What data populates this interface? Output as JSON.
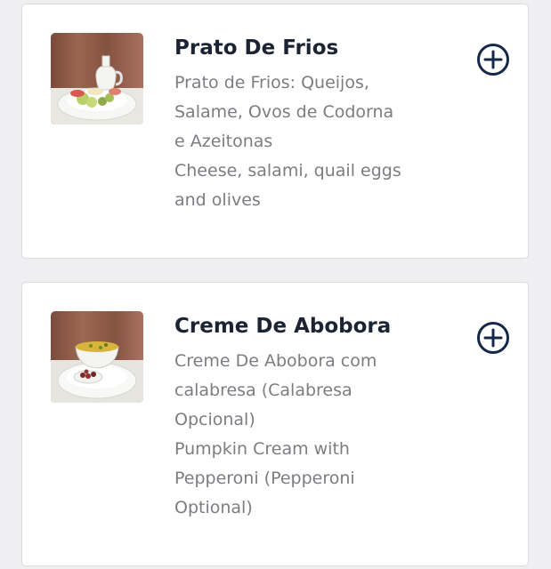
{
  "items": [
    {
      "title": "Prato De Frios",
      "description_lines": [
        "Prato de Frios: Queijos,",
        "Salame, Ovos de Codorna",
        "e Azeitonas",
        "Cheese, salami, quail eggs",
        "and olives"
      ],
      "image_icon": "cold-cuts-platter-photo",
      "add_icon": "plus-circle-icon"
    },
    {
      "title": "Creme De Abobora",
      "description_lines": [
        "Creme De Abobora com",
        "calabresa (Calabresa",
        "Opcional)",
        "Pumpkin Cream with",
        "Pepperoni (Pepperoni",
        "Optional)"
      ],
      "image_icon": "pumpkin-soup-photo",
      "add_icon": "plus-circle-icon"
    }
  ],
  "colors": {
    "background": "#efeff1",
    "card": "#ffffff",
    "title": "#1c2434",
    "description": "#7b7d81",
    "add_icon": "#16284a"
  }
}
